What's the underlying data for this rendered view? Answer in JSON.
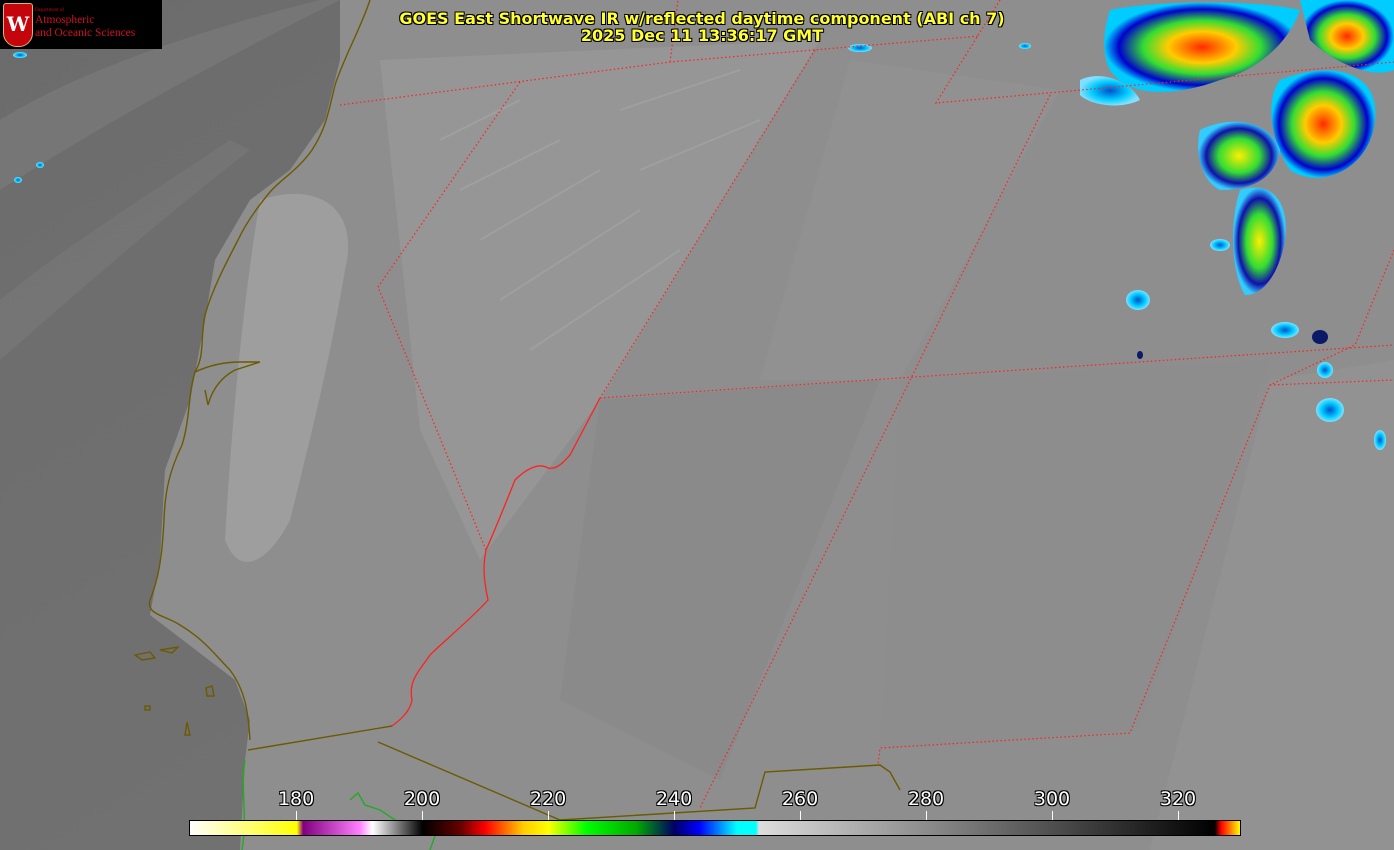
{
  "title": {
    "line1": "GOES East Shortwave IR w/reflected daytime component (ABI ch 7)",
    "line2": "2025 Dec 11 13:36:17 GMT"
  },
  "logo": {
    "crest": "W",
    "small_text": "Department of",
    "line1": "Atmospheric",
    "line2": "and Oceanic Sciences"
  },
  "colorbar": {
    "min": 163,
    "max": 330,
    "ticks": [
      "180",
      "200",
      "220",
      "240",
      "260",
      "280",
      "300",
      "320"
    ],
    "tick_values": [
      180,
      200,
      220,
      240,
      260,
      280,
      300,
      320
    ],
    "stops": [
      {
        "v": 163,
        "c": "#ffffff"
      },
      {
        "v": 180,
        "c": "#ffff00"
      },
      {
        "v": 181,
        "c": "#800080"
      },
      {
        "v": 190,
        "c": "#ff80ff"
      },
      {
        "v": 192,
        "c": "#ffffff"
      },
      {
        "v": 200,
        "c": "#000000"
      },
      {
        "v": 206,
        "c": "#660000"
      },
      {
        "v": 210,
        "c": "#ff0000"
      },
      {
        "v": 216,
        "c": "#ffcc00"
      },
      {
        "v": 220,
        "c": "#ffff00"
      },
      {
        "v": 226,
        "c": "#00ff00"
      },
      {
        "v": 234,
        "c": "#00aa00"
      },
      {
        "v": 240,
        "c": "#000066"
      },
      {
        "v": 244,
        "c": "#0000ff"
      },
      {
        "v": 250,
        "c": "#00ffff"
      },
      {
        "v": 253,
        "c": "#00ffff"
      },
      {
        "v": 253.5,
        "c": "#dddddd"
      },
      {
        "v": 326,
        "c": "#000000"
      },
      {
        "v": 327,
        "c": "#ff0000"
      },
      {
        "v": 330,
        "c": "#ffff00"
      }
    ]
  },
  "colors": {
    "title": "#ffff33",
    "state_border": "#ff2020",
    "coastline": "#6b5a00",
    "land_background": "#7a7a7a",
    "ocean_background": "#6a6a6a"
  }
}
